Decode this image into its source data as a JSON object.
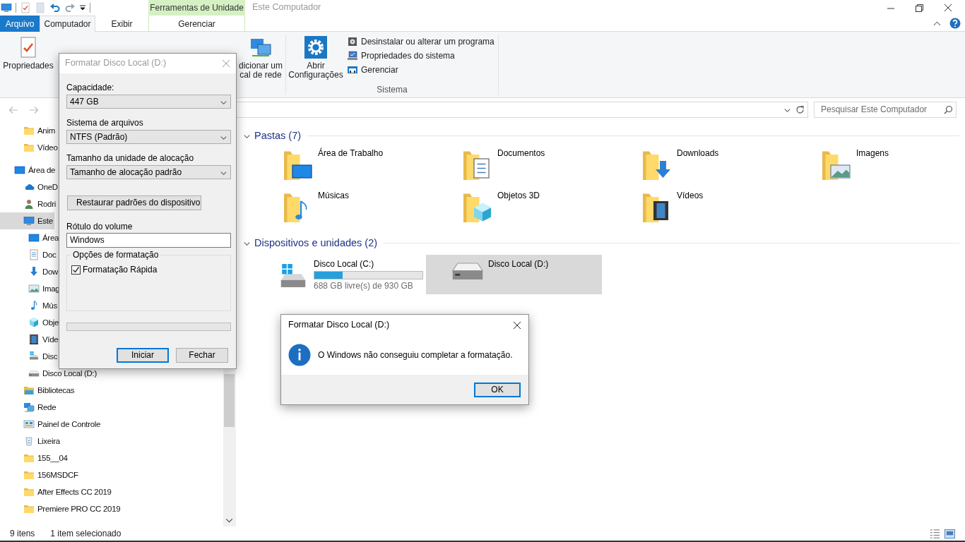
{
  "window": {
    "title": "Este Computador",
    "context_tab": "Ferramentas de Unidade"
  },
  "tabs": [
    {
      "label": "Arquivo",
      "kind": "file",
      "selected": false
    },
    {
      "label": "Computador",
      "kind": "tab",
      "selected": true
    },
    {
      "label": "Exibir",
      "kind": "tab",
      "selected": false
    },
    {
      "label": "Gerenciar",
      "kind": "context",
      "selected": false
    }
  ],
  "ribbon": {
    "buttons": [
      {
        "label": "Propriedades",
        "kind": "properties"
      },
      {
        "label": "dicionar um\ncal de rede",
        "kind": "network"
      }
    ],
    "system": {
      "label": "Sistema",
      "main": {
        "label": "Abrir Configurações",
        "kind": "gear"
      },
      "items": [
        {
          "label": "Desinstalar ou alterar um programa",
          "kind": "uninstall"
        },
        {
          "label": "Propriedades do sistema",
          "kind": "system"
        },
        {
          "label": "Gerenciar",
          "kind": "manage"
        }
      ]
    }
  },
  "search": {
    "placeholder": "Pesquisar Este Computador"
  },
  "sidebar": {
    "pinned": [
      {
        "label": "Anim",
        "kind": "folder",
        "selected": false
      },
      {
        "label": "Vídeo",
        "kind": "folder",
        "selected": false
      }
    ],
    "tree": [
      {
        "label": "Área de",
        "kind": "desktop",
        "selected": false,
        "children": [
          {
            "label": "OneD",
            "kind": "onedrive",
            "selected": false
          },
          {
            "label": "Rodri",
            "kind": "user",
            "selected": false
          },
          {
            "label": "Este",
            "kind": "computer",
            "selected": true,
            "children": [
              {
                "label": "Área",
                "kind": "desktop",
                "selected": false
              },
              {
                "label": "Doc",
                "kind": "documents",
                "selected": false
              },
              {
                "label": "Dow",
                "kind": "downloads",
                "selected": false
              },
              {
                "label": "Imag",
                "kind": "pictures",
                "selected": false
              },
              {
                "label": "Mús",
                "kind": "music",
                "selected": false
              },
              {
                "label": "Obje",
                "kind": "objects3d",
                "selected": false
              },
              {
                "label": "Víde",
                "kind": "videos",
                "selected": false
              },
              {
                "label": "Disc",
                "kind": "drive-windows",
                "selected": false
              },
              {
                "label": "Disco Local (D:)",
                "kind": "drive",
                "selected": false
              }
            ]
          },
          {
            "label": "Bibliotecas",
            "kind": "libraries",
            "selected": false
          },
          {
            "label": "Rede",
            "kind": "network",
            "selected": false
          },
          {
            "label": "Painel de Controle",
            "kind": "control",
            "selected": false
          },
          {
            "label": "Lixeira",
            "kind": "recycle",
            "selected": false
          },
          {
            "label": "155__04",
            "kind": "folder",
            "selected": false
          },
          {
            "label": "156MSDCF",
            "kind": "folder",
            "selected": false
          },
          {
            "label": "After Effects CC 2019",
            "kind": "folder",
            "selected": false
          },
          {
            "label": "Premiere PRO CC 2019",
            "kind": "folder",
            "selected": false
          }
        ]
      }
    ]
  },
  "groups": [
    {
      "title": "Pastas (7)",
      "kind": "folders",
      "expanded": true,
      "items": [
        {
          "label": "Área de Trabalho",
          "kind": "desktop",
          "selected": false
        },
        {
          "label": "Documentos",
          "kind": "documents",
          "selected": false
        },
        {
          "label": "Downloads",
          "kind": "downloads",
          "selected": false
        },
        {
          "label": "Imagens",
          "kind": "pictures",
          "selected": false
        },
        {
          "label": "Músicas",
          "kind": "music",
          "selected": false
        },
        {
          "label": "Objetos 3D",
          "kind": "objects3d",
          "selected": false
        },
        {
          "label": "Vídeos",
          "kind": "videos",
          "selected": false
        }
      ]
    },
    {
      "title": "Dispositivos e unidades (2)",
      "kind": "drives",
      "expanded": true,
      "items": [
        {
          "label": "Disco Local (C:)",
          "kind": "drive-windows",
          "selected": false,
          "level": 0.26,
          "free": "688 GB livre(s) de 930 GB"
        },
        {
          "label": "Disco Local (D:)",
          "kind": "drive",
          "selected": true
        }
      ]
    }
  ],
  "status_bar": {
    "count": "9 itens",
    "selection": "1 item selecionado"
  },
  "format_dialog": {
    "title": "Formatar Disco Local (D:)",
    "active": false,
    "fields": [
      {
        "label": "Capacidade:",
        "value": "447 GB"
      },
      {
        "label": "Sistema de arquivos",
        "value": "NTFS (Padrão)"
      },
      {
        "label": "Tamanho da unidade de alocação",
        "value": "Tamanho de alocação padrão"
      }
    ],
    "restore_button": {
      "label": "Restaurar padrões do dispositivo"
    },
    "volume_label": {
      "label": "Rótulo do volume",
      "value": "Windows"
    },
    "options": {
      "title": "Opções de formatação",
      "items": [
        {
          "label": "Formatação Rápida",
          "checked": true
        }
      ]
    },
    "progress": {
      "level": 0
    },
    "buttons": [
      {
        "label": "Iniciar",
        "default": true
      },
      {
        "label": "Fechar",
        "default": false
      }
    ]
  },
  "message_box": {
    "title": "Formatar Disco Local (D:)",
    "active": true,
    "kind": "info",
    "message": "O Windows não conseguiu completar a formatação.",
    "buttons": [
      {
        "label": "OK",
        "default": true
      }
    ]
  }
}
